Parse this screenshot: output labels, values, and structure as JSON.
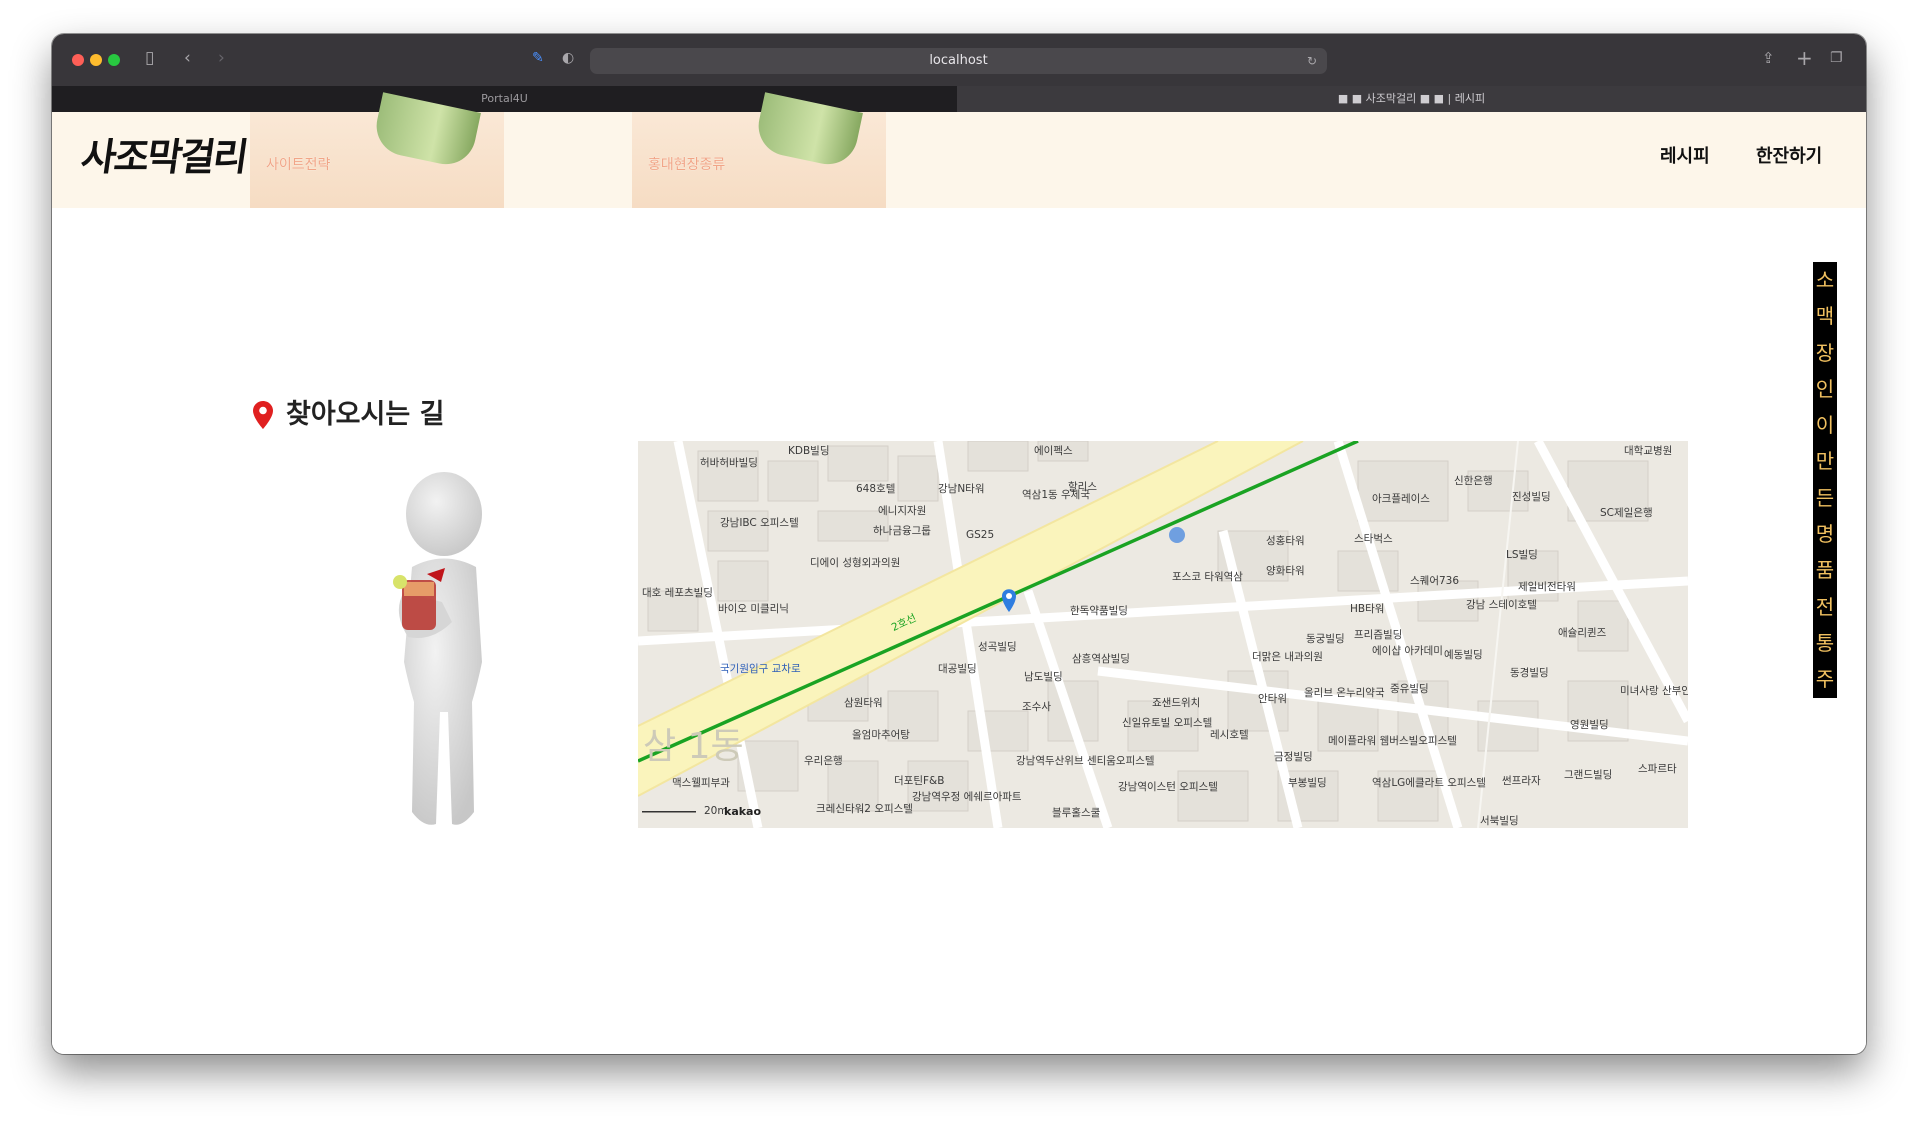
{
  "browser": {
    "url": "localhost",
    "tabs": [
      {
        "label": "Portal4U"
      },
      {
        "label": "■ ■ 사조막걸리 ■ ■ | 레시피"
      }
    ]
  },
  "site": {
    "logo": "사조막걸리",
    "banner_labels": [
      "사이트전략",
      "홍대현장종류"
    ],
    "nav": [
      "레시피",
      "한잔하기"
    ],
    "vertical_banner": [
      "소",
      "맥",
      "장",
      "인",
      "이",
      "만",
      "든",
      "명",
      "품",
      "전",
      "통",
      "주"
    ]
  },
  "section": {
    "title": "찾아오시는 길"
  },
  "map": {
    "attribution": "kakao",
    "scale_label": "20m",
    "line_label": "2호선",
    "watermark": "삼 1동",
    "labels": [
      "KDB빌딩",
      "허바허바빌딩",
      "648호텔",
      "강남N타워",
      "에니지자원",
      "하나금융그룹",
      "GS25",
      "역삼1동 우체국",
      "할리스",
      "에이펙스",
      "강남IBC 오피스텔",
      "디에이 성형외과의원",
      "바이오 미클리닉",
      "대호 레포츠빌딩",
      "국기원입구 교차로",
      "한독약품빌딩",
      "포스코 타워역삼",
      "성홍타워",
      "양화타워",
      "아크플레이스",
      "스타벅스",
      "신한은행",
      "진성빌딩",
      "대학교병원",
      "SC제일은행",
      "LS빌딩",
      "제일비전타워",
      "강남 스테이호텔",
      "스퀘어736",
      "HB타워",
      "프리즘빌딩",
      "동궁빌딩",
      "에이샵 아카데미",
      "올리브 온누리약국",
      "예동빌딩",
      "동경빌딩",
      "미녀사랑 산부인과의원",
      "애슐리퀸즈",
      "성곡빌딩",
      "대공빌딩",
      "남도빌딩",
      "조수사",
      "삼흥역삼빌딩",
      "죠샌드위치",
      "신일유토빌 오피스텔",
      "레시호텔",
      "더맑은 내과의원",
      "안타워",
      "중유빌딩",
      "삼원타워",
      "올엄마추어탕",
      "우리은행",
      "맥스웰피부과",
      "더포틴F&B",
      "강남역우정 에쉐르아파트",
      "크레신타워2 오피스텔",
      "강남역두산위브 센티움오피스텔",
      "블루홀스쿨",
      "강남역이스턴 오피스텔",
      "금정빌딩",
      "메이플라워 웸버스빌오피스텔",
      "부봉빌딩",
      "역삼LG에클라트 오피스텔",
      "썬프라자",
      "그랜드빌딩",
      "영원빌딩",
      "스파르타",
      "서북빌딩"
    ]
  },
  "colors": {
    "header_bg": "#fdf6ea",
    "accent_red": "#e02020",
    "subway_green": "#1aa323",
    "road_yellow": "#faf4bc",
    "map_pin": "#2e7de0"
  }
}
